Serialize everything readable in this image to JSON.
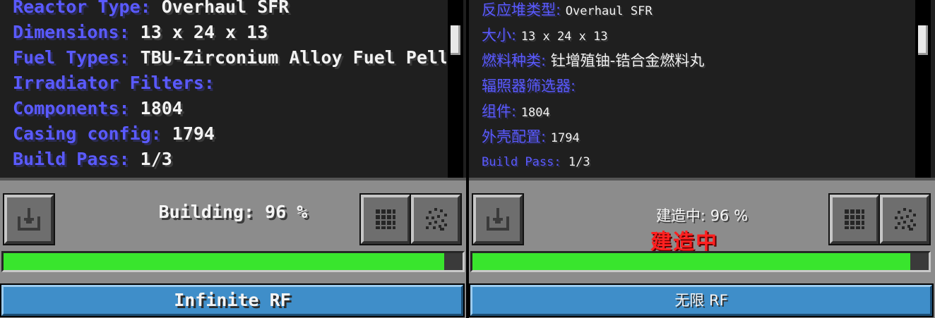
{
  "left_panel": {
    "info_lines": [
      {
        "key": "Reactor Type:",
        "value": "Overhaul SFR"
      },
      {
        "key": "Dimensions:",
        "value": "13 x 24 x 13"
      },
      {
        "key": "Fuel Types:",
        "value": "TBU-Zirconium Alloy Fuel Pell"
      },
      {
        "key": "Irradiator Filters:",
        "value": ""
      },
      {
        "key": "Components:",
        "value": "1804"
      },
      {
        "key": "Casing config:",
        "value": "1794"
      },
      {
        "key": "Build Pass:",
        "value": "1/3"
      }
    ],
    "status": "Building: 96 %",
    "progress_fraction": 0.96,
    "energy_label": "Infinite RF"
  },
  "right_panel": {
    "info_lines": [
      {
        "key": "反应堆类型:",
        "value": "Overhaul SFR"
      },
      {
        "key": "大小:",
        "value": "13 x 24 x 13"
      },
      {
        "key": "燃料种类:",
        "value": "钍增殖铀-锆合金燃料丸"
      },
      {
        "key": "辐照器筛选器:",
        "value": ""
      },
      {
        "key": "组件:",
        "value": "1804"
      },
      {
        "key": "外壳配置:",
        "value": "1794"
      },
      {
        "key": "Build Pass:",
        "value": "1/3"
      }
    ],
    "status": "建造中: 96 %",
    "overlay_label": "建造中",
    "progress_fraction": 0.96,
    "energy_label": "无限 RF"
  },
  "icons": {
    "import": "import-tray-icon",
    "grid": "grid-pattern-icon",
    "dotted": "dotted-pattern-icon"
  },
  "colors": {
    "key_text": "#5a5aff",
    "value_text": "#f2f2f2",
    "progress_fill": "#39e52d",
    "energy_button": "#3f8ec9",
    "overlay_red": "#ff2020"
  }
}
